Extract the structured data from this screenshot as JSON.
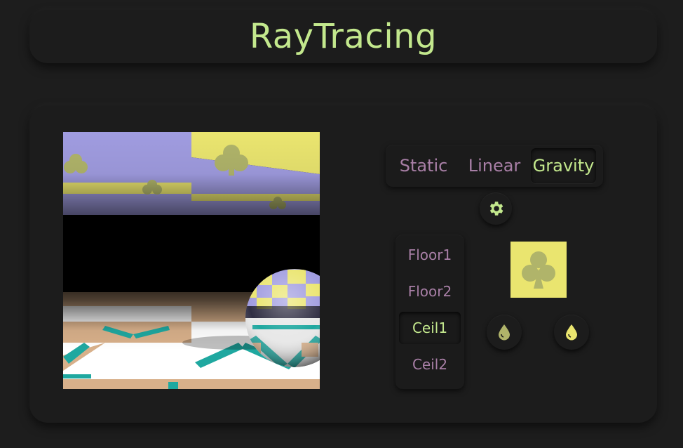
{
  "header": {
    "title": "RayTracing"
  },
  "modes": {
    "items": [
      {
        "label": "Static",
        "active": false
      },
      {
        "label": "Linear",
        "active": false
      },
      {
        "label": "Gravity",
        "active": true
      }
    ]
  },
  "settings": {
    "icon": "gear-icon"
  },
  "textures": {
    "items": [
      {
        "label": "Floor1",
        "active": false
      },
      {
        "label": "Floor2",
        "active": false
      },
      {
        "label": "Ceil1",
        "active": true
      },
      {
        "label": "Ceil2",
        "active": false
      }
    ]
  },
  "pattern": {
    "icon": "club-icon",
    "background": "#eae56f",
    "symbol_color": "#b0b46a"
  },
  "color_pickers": [
    {
      "icon": "droplet-icon",
      "color": "#b0b46a"
    },
    {
      "icon": "droplet-icon",
      "color": "#eae56f"
    }
  ],
  "colors": {
    "accent": "#c3e88d",
    "inactive": "#a87fa6",
    "ceiling_a": "#eae56f",
    "ceiling_b": "#a09ce0",
    "floor_a": "#d8b08a",
    "floor_b": "#ffffff",
    "floor_pattern": "#1fa8a0"
  }
}
